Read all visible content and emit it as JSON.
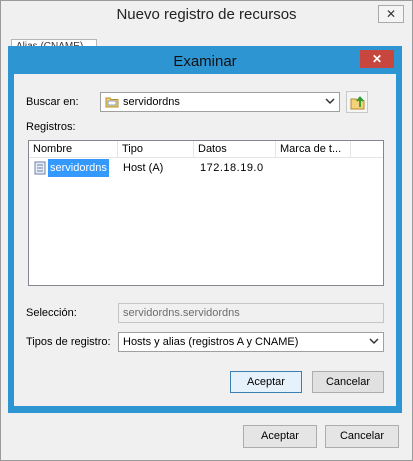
{
  "outer_window": {
    "title": "Nuevo registro de recursos",
    "close_glyph": "✕",
    "tab_label": "Alias (CNAME)",
    "ok_label": "Aceptar",
    "cancel_label": "Cancelar"
  },
  "dialog": {
    "title": "Examinar",
    "close_glyph": "✕",
    "look_in_label": "Buscar en:",
    "look_in_value": "servidordns",
    "records_label": "Registros:",
    "columns": [
      "Nombre",
      "Tipo",
      "Datos",
      "Marca de t..."
    ],
    "rows": [
      {
        "name": "servidordns",
        "type": "Host (A)",
        "data": "172.18.19.0",
        "timestamp": ""
      }
    ],
    "selection_label": "Selección:",
    "selection_value": "servidordns.servidordns",
    "record_types_label": "Tipos de registro:",
    "record_types_value": "Hosts y alias (registros A y CNAME)",
    "ok_label": "Aceptar",
    "cancel_label": "Cancelar"
  },
  "icons": {
    "folder": "folder-icon",
    "up_folder": "up-folder-icon",
    "server": "server-icon",
    "dropdown": "chevron-down-icon"
  },
  "colors": {
    "dialog_frame": "#2e95d3",
    "close_button": "#c7463e",
    "selection": "#3399ff"
  }
}
